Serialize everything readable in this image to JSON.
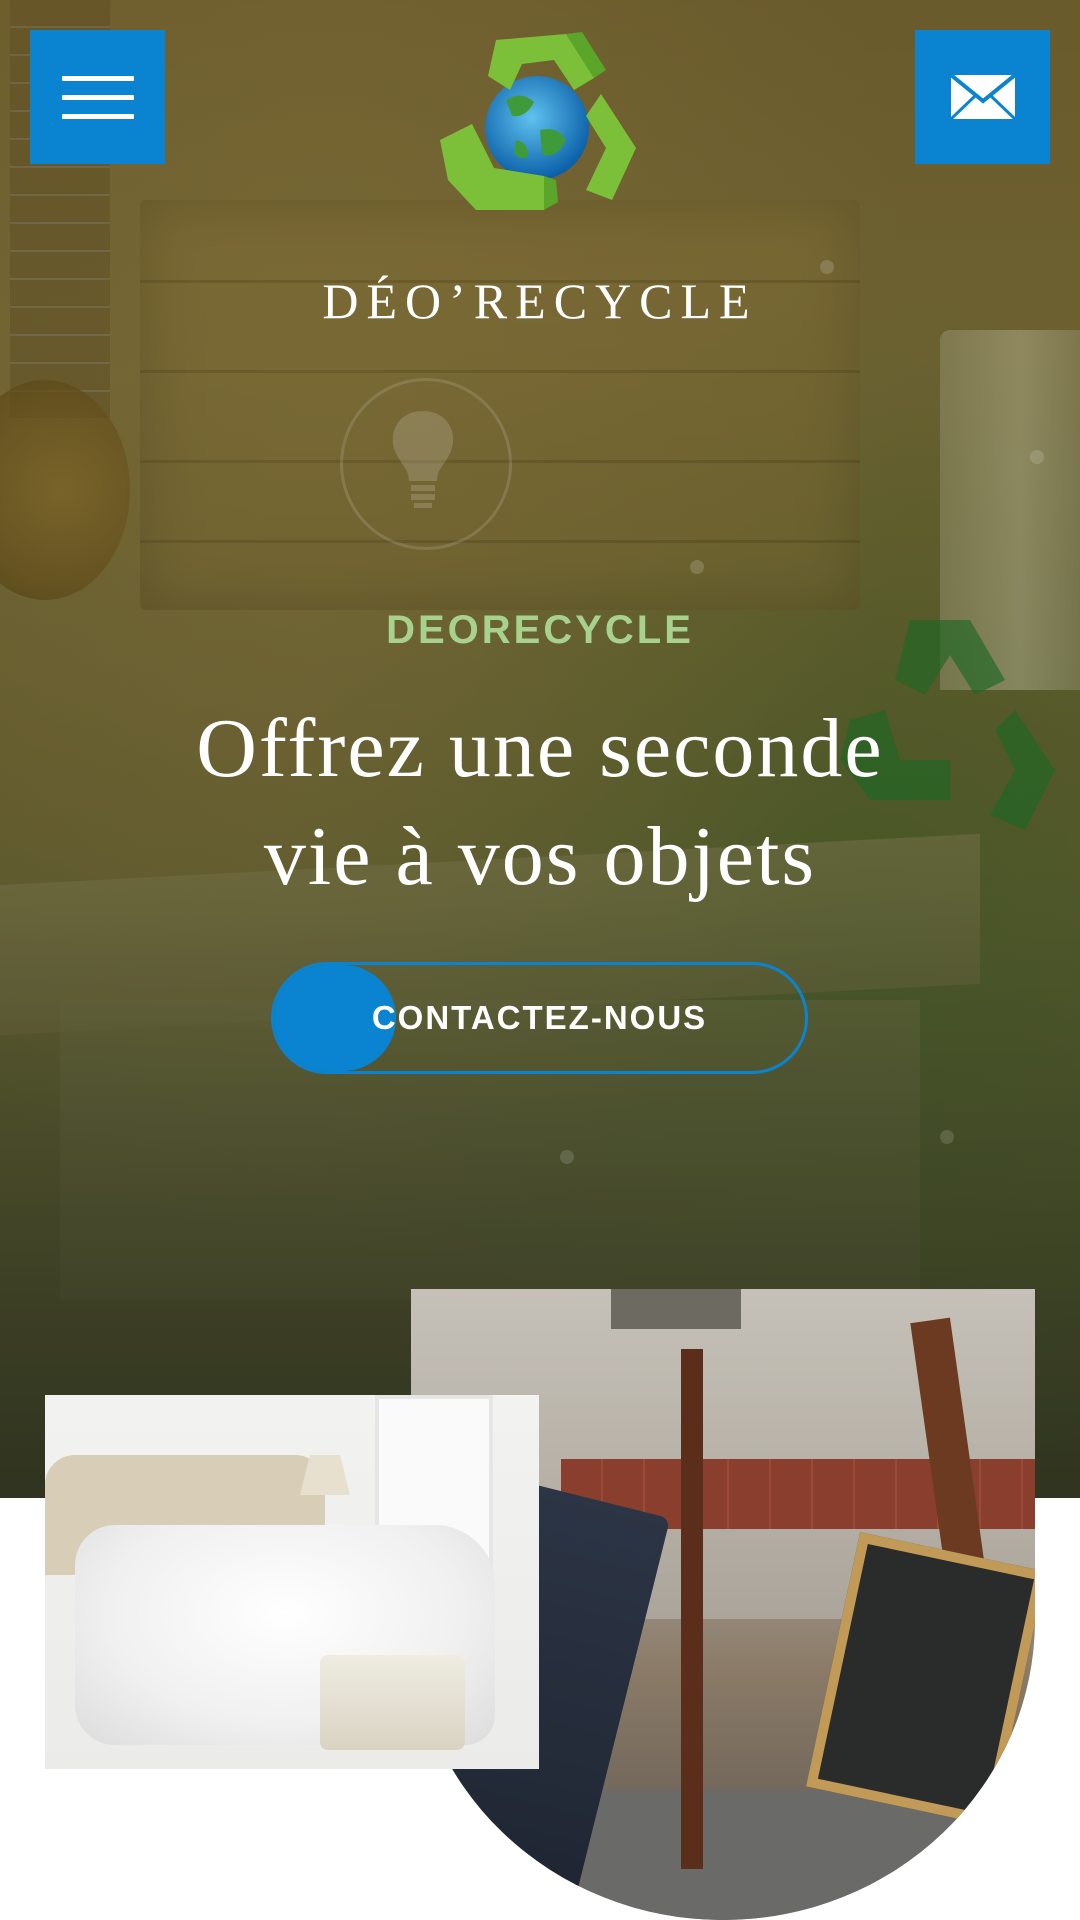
{
  "header": {
    "menu_icon": "hamburger-menu-icon",
    "mail_icon": "envelope-icon",
    "logo_icon": "recycle-globe-logo",
    "brand_name": "DÉO’RECYCLE"
  },
  "hero": {
    "tagline": "DEORECYCLE",
    "headline_line1": "Offrez une seconde",
    "headline_line2": "vie à vos objets",
    "cta_label": "CONTACTEZ-NOUS"
  },
  "images": {
    "photo_left": "bedroom-photo",
    "photo_right": "furniture-pile-photo"
  },
  "colors": {
    "accent_blue": "#0a84d0",
    "tagline_green": "#a9d18e",
    "text_white": "#ffffff"
  }
}
